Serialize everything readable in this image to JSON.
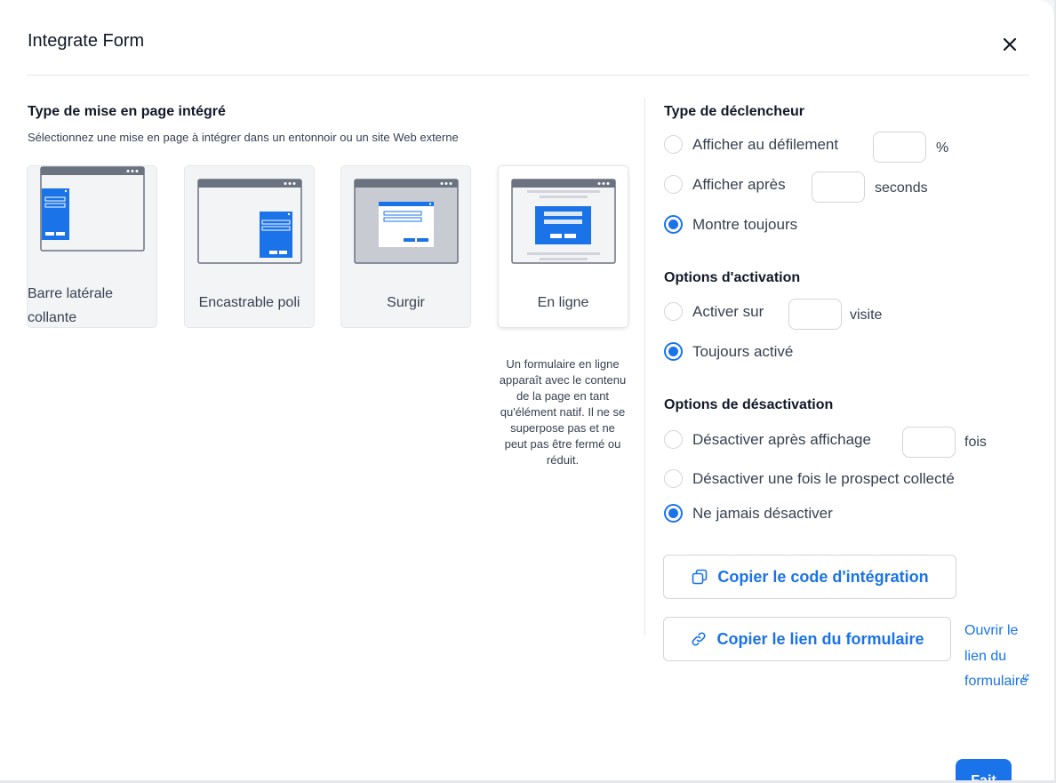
{
  "modal": {
    "title": "Integrate Form"
  },
  "layout_section": {
    "title": "Type de mise en page intégré",
    "subtitle": "Sélectionnez une mise en page à intégrer dans un entonnoir ou un site Web externe",
    "options": [
      {
        "label": "Barre latérale collante",
        "selected": false
      },
      {
        "label": "Encastrable poli",
        "selected": false
      },
      {
        "label": "Surgir",
        "selected": false
      },
      {
        "label": "En ligne",
        "selected": true
      }
    ],
    "description": "Un formulaire en ligne apparaît avec le contenu de la page en tant qu'élément natif. Il ne se superpose pas et ne peut pas être fermé ou réduit."
  },
  "trigger": {
    "title": "Type de déclencheur",
    "options": [
      {
        "label": "Afficher au défilement",
        "unit": "%",
        "value": "",
        "selected": false
      },
      {
        "label": "Afficher après",
        "unit": "seconds",
        "value": "",
        "selected": false
      },
      {
        "label": "Montre toujours",
        "selected": true
      }
    ]
  },
  "activation": {
    "title": "Options d'activation",
    "options": [
      {
        "label": "Activer sur",
        "unit": "visite",
        "value": "",
        "selected": false
      },
      {
        "label": "Toujours activé",
        "selected": true
      }
    ]
  },
  "deactivation": {
    "title": "Options de désactivation",
    "options": [
      {
        "label": "Désactiver après affichage",
        "unit": "fois",
        "value": "",
        "selected": false
      },
      {
        "label": "Désactiver une fois le prospect collecté",
        "selected": false
      },
      {
        "label": "Ne jamais désactiver",
        "selected": true
      }
    ]
  },
  "actions": {
    "copy_code": "Copier le code d'intégration",
    "copy_link": "Copier le lien du formulaire",
    "open_link": "Ouvrir le lien du formulaire",
    "done": "Fait"
  },
  "colors": {
    "accent": "#1a73e8",
    "thumb_frame": "#6b7280",
    "thumb_bg": "#f3f4f6"
  },
  "icons": [
    "close-icon",
    "copy-icon",
    "link-icon",
    "external-link-icon"
  ]
}
